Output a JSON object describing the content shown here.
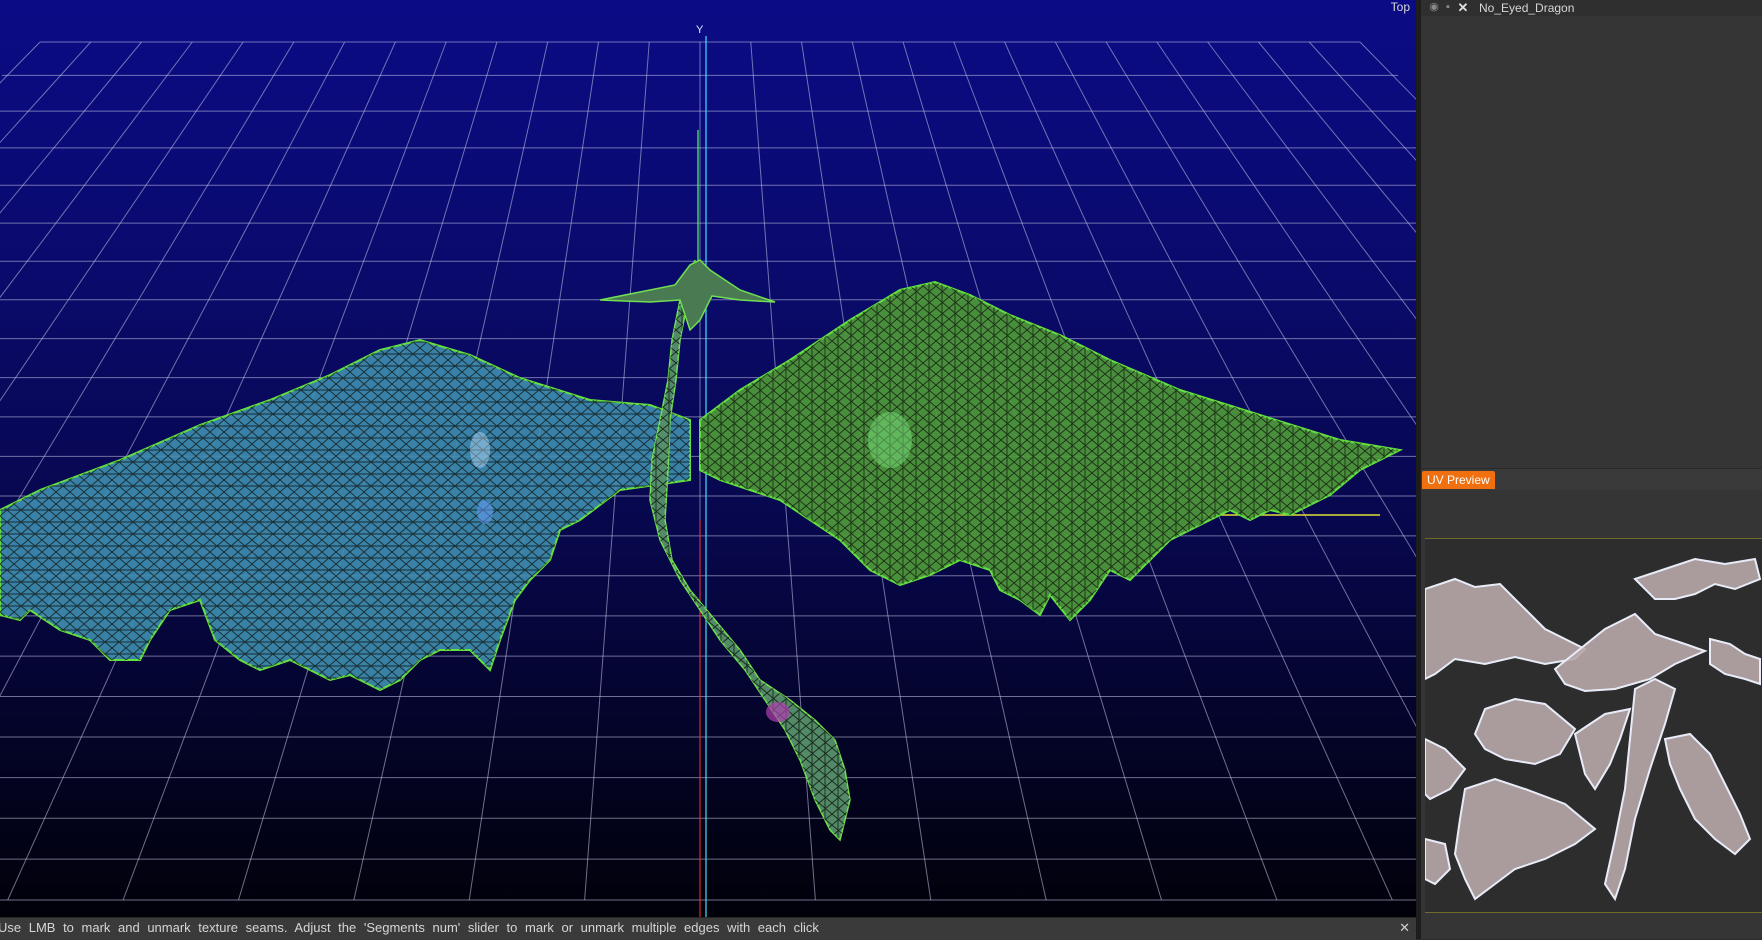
{
  "viewport": {
    "view_name": "Top",
    "axis_label": "Y",
    "colors": {
      "background_top": "#0b0b86",
      "background_bottom": "#01010a",
      "grid": "#c8c8e8",
      "left_wing": "#3f8fb0",
      "right_wing": "#4f9a3a",
      "wireframe": "#0a0f08",
      "y_axis": "#40e0ff",
      "x_axis": "#ff3030"
    }
  },
  "status_bar": {
    "message": "Use LMB to mark and unmark texture seams. Adjust the 'Segments num' slider to mark or unmark multiple edges with each click",
    "close_glyph": "✕"
  },
  "layers_panel": {
    "layer_name": "No_Eyed_Dragon",
    "eye_icon": "eye-icon",
    "lock_icon": "lock-icon",
    "delete_icon": "close-icon",
    "eye_glyph": "◉",
    "lock_glyph": "▪",
    "delete_glyph": "✕"
  },
  "uv_preview": {
    "tab_label": "UV Preview",
    "colors": {
      "accent": "#f07010",
      "island_fill": "#b8a8a8",
      "island_edge": "#e8ecf8",
      "background": "#2d2d2d"
    }
  }
}
